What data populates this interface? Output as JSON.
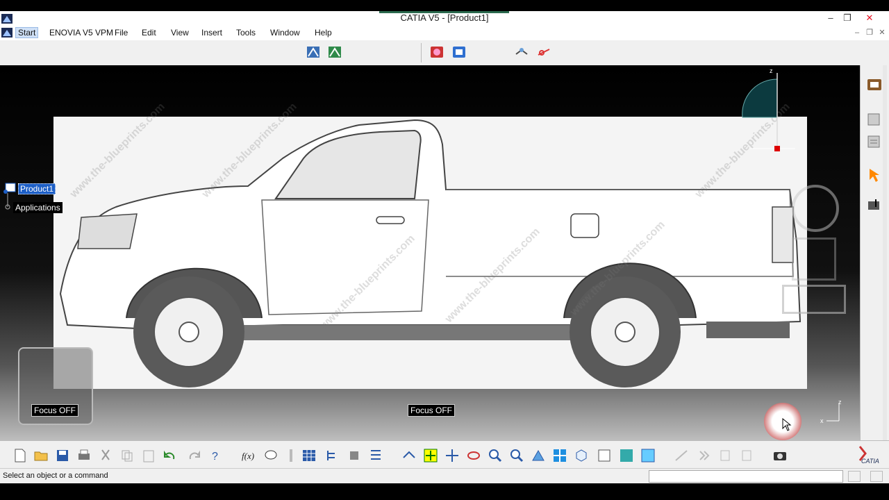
{
  "window": {
    "title": "CATIA V5 - [Product1]",
    "controls": [
      "–",
      "❐",
      "✕"
    ],
    "doc_controls": [
      "–",
      "❐",
      "✕"
    ]
  },
  "menubar": {
    "items": [
      "Start",
      "ENOVIA V5 VPM",
      "File",
      "Edit",
      "View",
      "Insert",
      "Tools",
      "Window",
      "Help"
    ]
  },
  "tree": {
    "root": "Product1",
    "child": "Applications"
  },
  "viewport": {
    "focus_left": "Focus OFF",
    "focus_center": "Focus OFF",
    "compass_z": "z",
    "axis_z": "z",
    "axis_x": "x",
    "watermark": "www.the-blueprints.com"
  },
  "status": {
    "message": "Select an object or a command"
  },
  "brand": {
    "logo_text": "CATIA",
    "accent": "#2b6a4e",
    "selection": "#1d5fc7"
  }
}
